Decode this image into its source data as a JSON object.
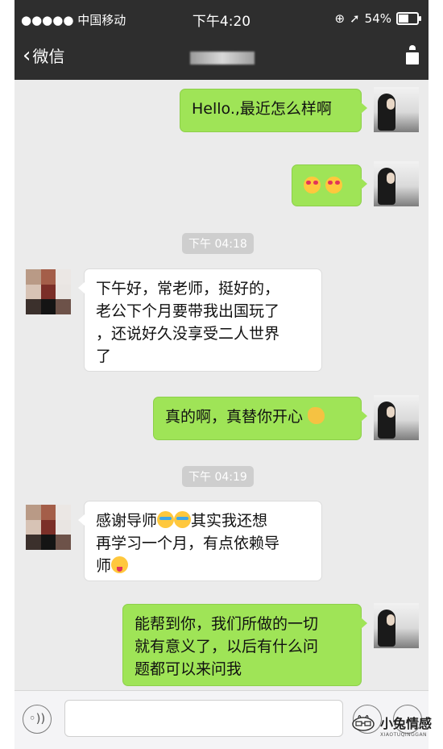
{
  "status_bar": {
    "carrier": "●●●●● 中国移动",
    "time": "下午4:20",
    "battery": "54%",
    "battery_level": 0.54
  },
  "nav": {
    "back_label": "微信"
  },
  "messages": [
    {
      "from": "me",
      "text": "Hello.,最近怎么样啊"
    },
    {
      "from": "me",
      "emojis": [
        "heart-eyes-emoji",
        "heart-eyes-emoji"
      ]
    },
    {
      "type": "time",
      "text": "下午 04:18"
    },
    {
      "from": "them",
      "lines": [
        "下午好，常老师，挺好的，",
        "老公下个月要带我出国玩了",
        "，还说好久没享受二人世界",
        "了"
      ]
    },
    {
      "from": "me",
      "text": "真的啊，真替你开心",
      "emoji": "clap-emoji"
    },
    {
      "type": "time",
      "text": "下午 04:19"
    },
    {
      "from": "them",
      "lines": [
        "感谢导师",
        "其实我还想",
        "再学习一个月，有点依赖导",
        "师"
      ],
      "emojis": [
        "crying-emoji",
        "crying-emoji",
        "tongue-emoji"
      ]
    },
    {
      "from": "me",
      "lines": [
        "能帮到你，我们所做的一切",
        "就有意义了，以后有什么问",
        "题都可以来问我"
      ]
    }
  ],
  "colors": {
    "nav_bg": "#2e2e2e",
    "chat_bg": "#ebebeb",
    "my_bubble": "#9fe457",
    "their_bubble": "#ffffff",
    "time_badge": "#cecece"
  },
  "watermark": {
    "name": "小兔情感",
    "sub": "XIAOTUQINGGAN"
  }
}
